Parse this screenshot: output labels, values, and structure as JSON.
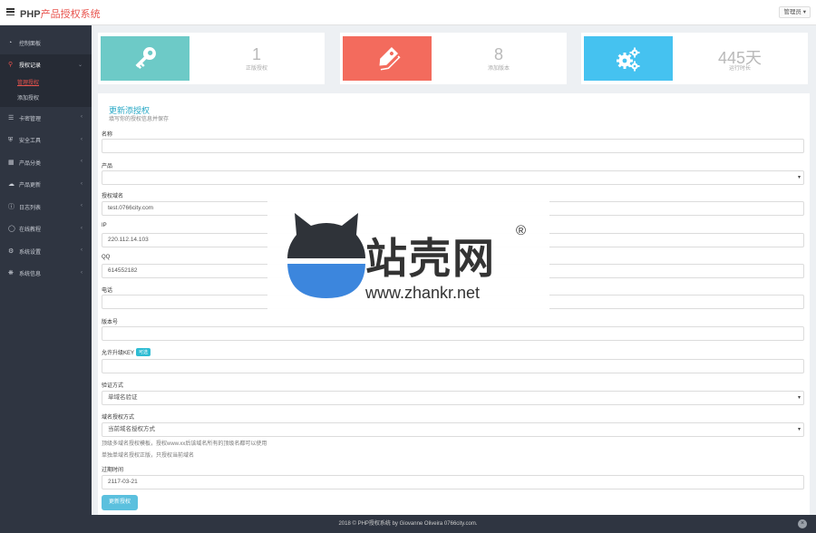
{
  "app": {
    "brand_prefix": "PHP",
    "brand_accent": "产品授权系统",
    "user_menu": "管理员 ▾"
  },
  "colors": {
    "accent": "#e8534d",
    "sidebar_bg": "#2f3541",
    "teal": "#6dcac7",
    "coral": "#f36b5d",
    "sky": "#45c2f0",
    "button": "#5bc0de"
  },
  "sidebar": {
    "items": [
      {
        "label": "控制面板",
        "icon": "dashboard-icon"
      },
      {
        "label": "授权记录",
        "icon": "key-icon",
        "active": true
      },
      {
        "label": "卡密管理",
        "icon": "list-icon"
      },
      {
        "label": "安全工具",
        "icon": "shield-icon"
      },
      {
        "label": "产品分类",
        "icon": "grid-icon"
      },
      {
        "label": "产品更新",
        "icon": "cloud-icon"
      },
      {
        "label": "日志列表",
        "icon": "info-icon"
      },
      {
        "label": "在线教程",
        "icon": "globe-icon"
      },
      {
        "label": "系统设置",
        "icon": "gears-icon"
      },
      {
        "label": "系统信息",
        "icon": "settings-icon"
      }
    ],
    "subitems": [
      {
        "label": "管理授权",
        "current": true
      },
      {
        "label": "添加授权"
      }
    ]
  },
  "stats": [
    {
      "value": "1",
      "label": "正版授权",
      "icon": "key-icon"
    },
    {
      "value": "8",
      "label": "添加版本",
      "icon": "tag-icon"
    },
    {
      "value": "445天",
      "label": "运行时长",
      "icon": "gears-icon"
    }
  ],
  "form": {
    "title": "更新添授权",
    "subtitle": "填写你的授权信息并保存",
    "name_label": "名称",
    "name_value": "",
    "product_label": "产品",
    "product_value": "",
    "domain_label": "授权域名",
    "domain_value": "test.0766city.com",
    "ip_label": "IP",
    "ip_value": "220.112.14.103",
    "qq_label": "QQ",
    "qq_value": "614552182",
    "phone_label": "电话",
    "phone_value": "",
    "version_label": "版本号",
    "version_value": "",
    "key_label": "允许升级KEY",
    "key_badge": "可选",
    "key_value": "",
    "verify_label": "验证方式",
    "verify_value": "单域名验证",
    "mode_label": "域名授权方式",
    "mode_value": "当前域名授权方式",
    "hint1": "顶级多域名授权模板，授权www.xx后该域名所有的顶级名都可以使用",
    "hint2": "单独单域名授权正版，只授权当前域名",
    "expiry_label": "过期时间",
    "expiry_value": "2117-03-21",
    "submit_label": "更新授权"
  },
  "footer": {
    "text": "2018 © PHP授权系统 by Giovanne Oliveira 0766city.com."
  },
  "watermark": {
    "cn": "站壳网",
    "url": "www.zhankr.net",
    "reg": "®"
  }
}
